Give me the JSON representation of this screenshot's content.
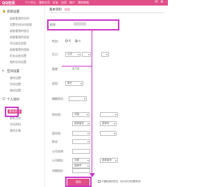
{
  "topbar": {
    "logo": "QQ空间",
    "nav": [
      "个人中心",
      "我的主页",
      "好友",
      "应用",
      "账户",
      "我的商城"
    ]
  },
  "sidebar": {
    "sections": [
      {
        "title": "权限设置",
        "items": [
          "谁能看我的空间",
          "设置空间访问权限",
          "谁能看我的留言",
          "谁能看我的说说",
          "评论留言权限",
          "谁能看我的相册",
          "好友动态设置",
          "我的空间设置"
        ]
      },
      {
        "title": "空间设置",
        "items": [
          "我的设置",
          "空间设置",
          "装扮设置"
        ]
      },
      {
        "title": "个人资料",
        "items": [
          "基本资料",
          "联系方式",
          "空间资料",
          "我的头像"
        ]
      }
    ],
    "active_item": "基本资料"
  },
  "main": {
    "tab_basic": "基本资料",
    "tab_modify": "修改",
    "nickname_label": "昵称：",
    "gender_label": "性别：",
    "gender_male": "男",
    "gender_female": "女",
    "birthday_label": "生日：",
    "birthday_type": "公历",
    "zodiac_label": "星座：",
    "zodiac_value": "金牛座",
    "blood_label": "血型：",
    "blood_value": "其它",
    "marriage_label": "婚姻状况：",
    "hometown_label": "所在地：",
    "country_value": "中国",
    "province_placeholder": "选择省份",
    "city_placeholder": "选择市",
    "live_label": "居住地：",
    "job_label": "职业：",
    "company_label": "公司名称：",
    "company_addr_label": "公司地址：",
    "company_addr_country": "中国",
    "detail_addr_label": "详细地址：",
    "save_label": "保存",
    "notify_text": "不通知我的好友（仅对本次设置有效）"
  }
}
